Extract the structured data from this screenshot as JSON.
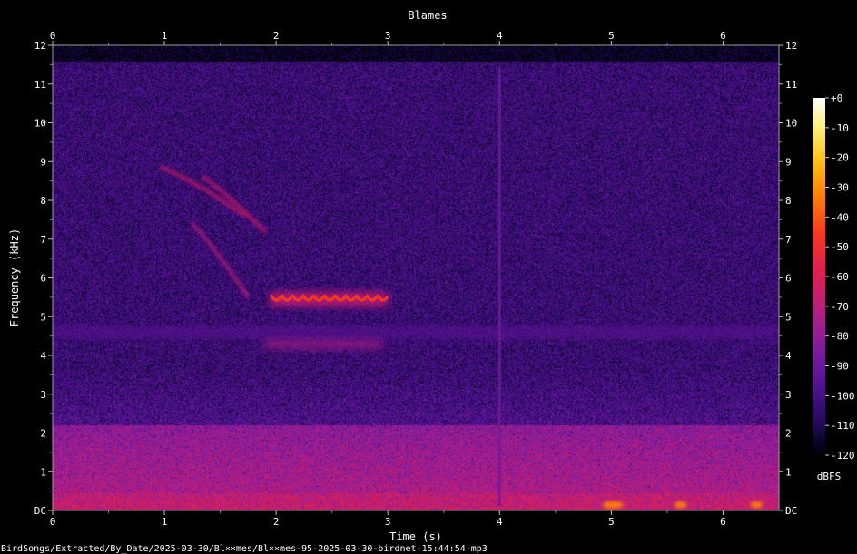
{
  "page": {
    "title": "Blames",
    "file_path": "BirdSongs/Extracted/By_Date/2025-03-30/Bl××mes/Bl××mes-95-2025-03-30-birdnet-15:44:54⋅mp3"
  },
  "chart_data": {
    "type": "heatmap",
    "title": "Blames",
    "xlabel": "Time (s)",
    "ylabel": "Frequency (kHz)",
    "xlim": [
      0,
      6.5
    ],
    "ylim": [
      0,
      12
    ],
    "x_ticks": [
      0,
      1,
      2,
      3,
      4,
      5,
      6
    ],
    "y_ticks": [
      "DC",
      "1",
      "2",
      "3",
      "4",
      "5",
      "6",
      "7",
      "8",
      "9",
      "10",
      "11",
      "12"
    ],
    "colorbar": {
      "label": "dBFS",
      "range": [
        -120,
        0
      ],
      "ticks": [
        "+0",
        "-10",
        "-20",
        "-30",
        "-40",
        "-50",
        "-60",
        "-70",
        "-80",
        "-90",
        "-100",
        "-110",
        "-120"
      ]
    },
    "colormap": [
      "#000000",
      "#0b0530",
      "#2a0a62",
      "#4b118a",
      "#6e1a9e",
      "#951e96",
      "#bd1f7a",
      "#e01f4f",
      "#f5391f",
      "#fb7d07",
      "#fdbf16",
      "#fdef7a",
      "#ffffff"
    ],
    "noise_floor": {
      "high_freq_khz": 11.6,
      "level_dbfs": -95,
      "low_freq_band": {
        "from_khz": 0,
        "to_khz": 2.2,
        "level_dbfs": -62
      }
    },
    "features": [
      {
        "kind": "descending_sweep",
        "t": [
          0.97,
          1.25,
          1.72
        ],
        "f_khz": [
          8.85,
          8.55,
          7.6
        ],
        "level_dbfs": -55
      },
      {
        "kind": "descending_sweep",
        "t": [
          1.35,
          1.55,
          1.9
        ],
        "f_khz": [
          8.6,
          8.2,
          7.2
        ],
        "level_dbfs": -55
      },
      {
        "kind": "descending_sweep",
        "t": [
          1.25,
          1.45,
          1.75
        ],
        "f_khz": [
          7.4,
          6.8,
          5.5
        ],
        "level_dbfs": -60
      },
      {
        "kind": "trill",
        "t_start": 1.95,
        "t_end": 3.0,
        "f_khz": 5.45,
        "note_count": 11,
        "level_dbfs": -40
      },
      {
        "kind": "band",
        "t_start": 1.9,
        "t_end": 2.95,
        "f_khz": 4.3,
        "level_dbfs": -65
      },
      {
        "kind": "band",
        "t_start": 0.0,
        "t_end": 6.5,
        "f_khz": 4.6,
        "level_dbfs": -85
      },
      {
        "kind": "click",
        "t": 4.0,
        "level_dbfs": -80
      },
      {
        "kind": "hot_spots",
        "t": [
          4.98,
          5.05,
          5.62,
          6.3
        ],
        "f_khz": 0.1,
        "level_dbfs": -30
      }
    ]
  }
}
